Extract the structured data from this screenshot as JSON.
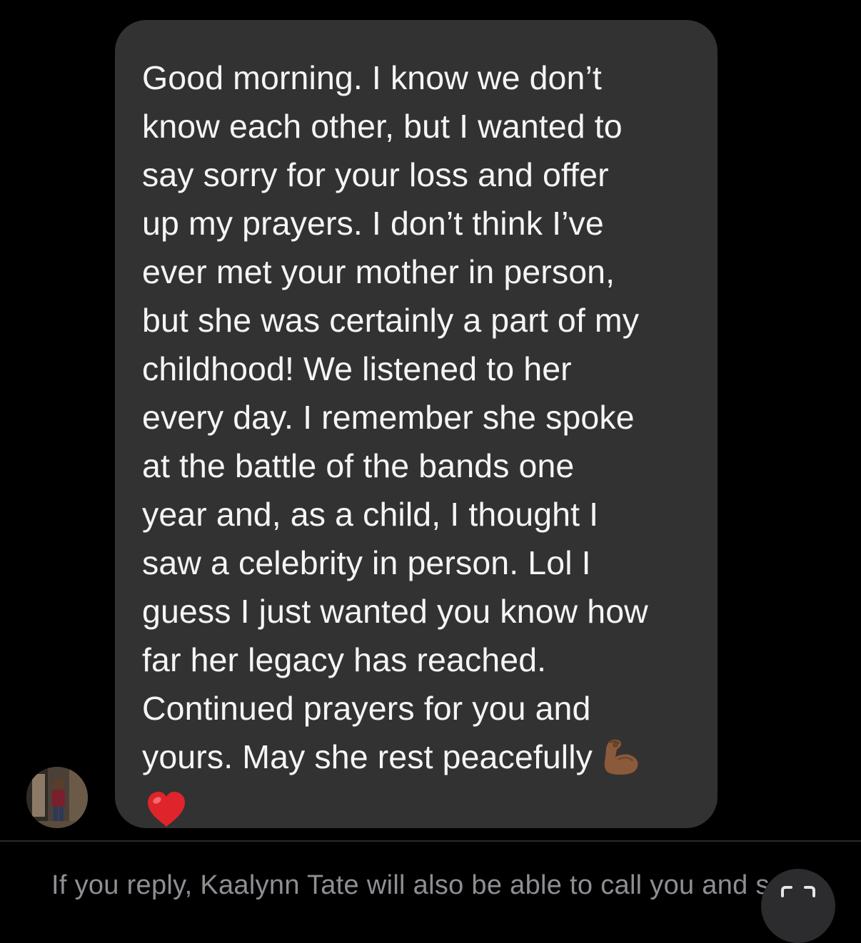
{
  "conversation": {
    "message": {
      "text": "Good morning. I know we don’t\nknow each other, but I wanted to\nsay sorry for your loss and offer\nup my prayers. I don’t think I’ve\never met your mother in person,\nbut she was certainly a part of my\nchildhood! We listened to her\nevery day. I remember she spoke\nat the battle of the bands one\nyear and, as a child, I thought I\nsaw a celebrity in person. Lol I\nguess I just wanted you know how\nfar her legacy has reached.\nContinued prayers for you and\nyours. May she rest peacefully",
      "trailing_emojis": [
        "flexed-biceps-icon",
        "red-heart-icon"
      ]
    },
    "sender": {
      "avatar": "sender-avatar"
    }
  },
  "footer": {
    "note": "If you reply, Kaalynn Tate will also be able to call you and s",
    "button_icon": "scan-icon"
  },
  "colors": {
    "background": "#000000",
    "bubble": "#323232",
    "text": "#f5f5f5",
    "muted_text": "#8e8e93",
    "heart": "#e0242b",
    "biceps": "#8a5a3a"
  }
}
